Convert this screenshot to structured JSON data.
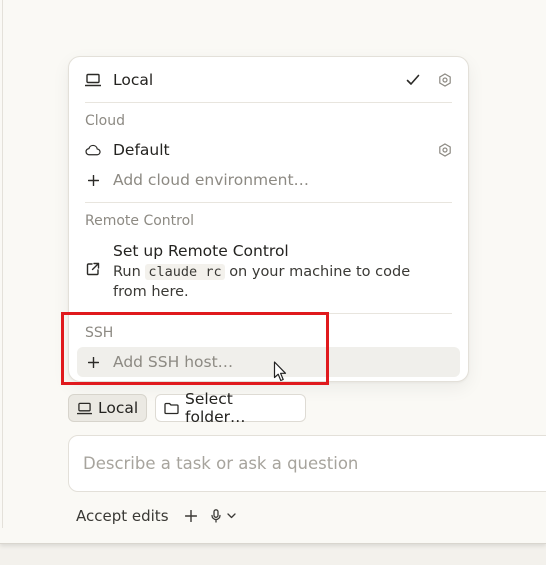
{
  "menu": {
    "local": {
      "label": "Local",
      "icon": "laptop-icon",
      "selected": true
    },
    "cloud": {
      "title": "Cloud",
      "default_label": "Default",
      "add_label": "Add cloud environment…"
    },
    "remote": {
      "title": "Remote Control",
      "setup_label": "Set up Remote Control",
      "desc_prefix": "Run",
      "desc_code": "claude rc",
      "desc_suffix": "on your machine to code",
      "desc_line2": "from here."
    },
    "ssh": {
      "title": "SSH",
      "add_label": "Add SSH host…"
    }
  },
  "chips": {
    "local_label": "Local",
    "folder_label": "Select folder…"
  },
  "composer": {
    "placeholder": "Describe a task or ask a question"
  },
  "bottom": {
    "accept_label": "Accept edits"
  },
  "colors": {
    "highlight": "#e0191d",
    "accent_text": "#242320",
    "muted_text": "#8d8a83"
  }
}
